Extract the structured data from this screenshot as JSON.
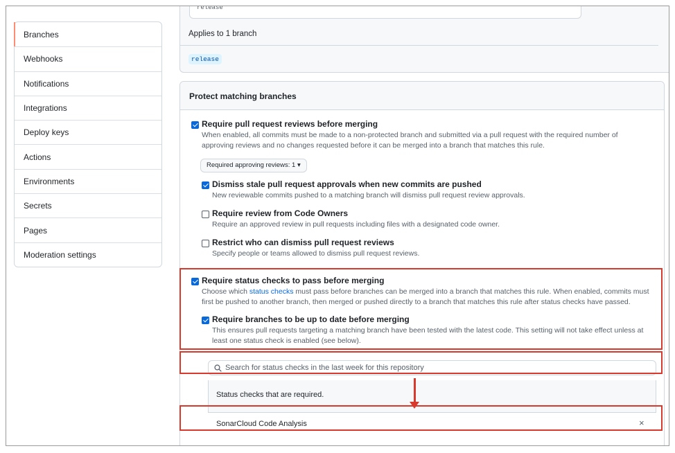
{
  "sidebar": {
    "items": [
      {
        "label": "Branches",
        "active": true
      },
      {
        "label": "Webhooks"
      },
      {
        "label": "Notifications"
      },
      {
        "label": "Integrations"
      },
      {
        "label": "Deploy keys"
      },
      {
        "label": "Actions"
      },
      {
        "label": "Environments"
      },
      {
        "label": "Secrets"
      },
      {
        "label": "Pages"
      },
      {
        "label": "Moderation settings"
      }
    ]
  },
  "branch_rule": {
    "pattern_value": "release",
    "applies_text": "Applies to 1 branch",
    "matched_branch": "release"
  },
  "protect": {
    "heading": "Protect matching branches",
    "require_pr_reviews": {
      "title": "Require pull request reviews before merging",
      "desc": "When enabled, all commits must be made to a non-protected branch and submitted via a pull request with the required number of approving reviews and no changes requested before it can be merged into a branch that matches this rule.",
      "checked": true,
      "approvals_select": "Required approving reviews: 1"
    },
    "dismiss_stale": {
      "title": "Dismiss stale pull request approvals when new commits are pushed",
      "desc": "New reviewable commits pushed to a matching branch will dismiss pull request review approvals.",
      "checked": true
    },
    "code_owners": {
      "title": "Require review from Code Owners",
      "desc": "Require an approved review in pull requests including files with a designated code owner.",
      "checked": false
    },
    "restrict_dismiss": {
      "title": "Restrict who can dismiss pull request reviews",
      "desc": "Specify people or teams allowed to dismiss pull request reviews.",
      "checked": false
    },
    "status_checks": {
      "title": "Require status checks to pass before merging",
      "desc_before": "Choose which ",
      "desc_link": "status checks",
      "desc_after": " must pass before branches can be merged into a branch that matches this rule. When enabled, commits must first be pushed to another branch, then merged or pushed directly to a branch that matches this rule after status checks have passed.",
      "checked": true
    },
    "up_to_date": {
      "title": "Require branches to be up to date before merging",
      "desc": "This ensures pull requests targeting a matching branch have been tested with the latest code. This setting will not take effect unless at least one status check is enabled (see below).",
      "checked": true
    },
    "search_placeholder": "Search for status checks in the last week for this repository",
    "required_heading": "Status checks that are required.",
    "required_checks": [
      "SonarCloud Code Analysis"
    ],
    "remove_symbol": "×"
  },
  "annotation_color": "#d9382c"
}
